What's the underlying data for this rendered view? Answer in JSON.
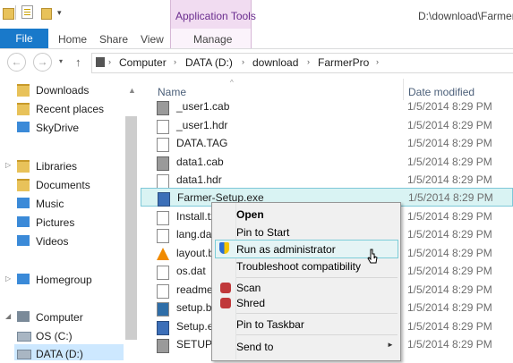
{
  "window": {
    "path_title": "D:\\download\\FarmerPro",
    "contextual_tab_group": "Application Tools"
  },
  "ribbon": {
    "tabs": [
      "File",
      "Home",
      "Share",
      "View",
      "Manage"
    ]
  },
  "address": {
    "crumbs": [
      "Computer",
      "DATA (D:)",
      "download",
      "FarmerPro"
    ]
  },
  "nav": {
    "items": [
      {
        "label": "Downloads",
        "icon": "downloads-icon"
      },
      {
        "label": "Recent places",
        "icon": "recent-places-icon"
      },
      {
        "label": "SkyDrive",
        "icon": "skydrive-icon"
      },
      {
        "label": "Libraries",
        "icon": "libraries-icon"
      },
      {
        "label": "Documents",
        "icon": "documents-icon"
      },
      {
        "label": "Music",
        "icon": "music-icon"
      },
      {
        "label": "Pictures",
        "icon": "pictures-icon"
      },
      {
        "label": "Videos",
        "icon": "videos-icon"
      },
      {
        "label": "Homegroup",
        "icon": "homegroup-icon"
      },
      {
        "label": "Computer",
        "icon": "computer-icon"
      },
      {
        "label": "OS (C:)",
        "icon": "drive-icon"
      },
      {
        "label": "DATA (D:)",
        "icon": "drive-icon"
      }
    ]
  },
  "columns": {
    "name": "Name",
    "date": "Date modified"
  },
  "files": [
    {
      "name": "_user1.cab",
      "date": "1/5/2014 8:29 PM",
      "icon": "cab-file-icon"
    },
    {
      "name": "_user1.hdr",
      "date": "1/5/2014 8:29 PM",
      "icon": "file-icon"
    },
    {
      "name": "DATA.TAG",
      "date": "1/5/2014 8:29 PM",
      "icon": "file-icon"
    },
    {
      "name": "data1.cab",
      "date": "1/5/2014 8:29 PM",
      "icon": "cab-file-icon"
    },
    {
      "name": "data1.hdr",
      "date": "1/5/2014 8:29 PM",
      "icon": "file-icon"
    },
    {
      "name": "Farmer-Setup.exe",
      "date": "1/5/2014 8:29 PM",
      "icon": "exe-icon"
    },
    {
      "name": "Install.tx",
      "date": "1/5/2014 8:29 PM",
      "icon": "text-file-icon"
    },
    {
      "name": "lang.dat",
      "date": "1/5/2014 8:29 PM",
      "icon": "file-icon"
    },
    {
      "name": "layout.b",
      "date": "1/5/2014 8:29 PM",
      "icon": "vlc-icon"
    },
    {
      "name": "os.dat",
      "date": "1/5/2014 8:29 PM",
      "icon": "file-icon"
    },
    {
      "name": "readme",
      "date": "1/5/2014 8:29 PM",
      "icon": "text-file-icon"
    },
    {
      "name": "setup.b",
      "date": "1/5/2014 8:29 PM",
      "icon": "image-file-icon"
    },
    {
      "name": "Setup.ex",
      "date": "1/5/2014 8:29 PM",
      "icon": "exe-icon"
    },
    {
      "name": "SETUP.I",
      "date": "1/5/2014 8:29 PM",
      "icon": "settings-file-icon"
    }
  ],
  "context_menu": {
    "items": [
      {
        "label": "Open",
        "bold": true
      },
      {
        "label": "Pin to Start"
      },
      {
        "label": "Run as administrator",
        "icon": "uac-shield-icon",
        "highlighted": true
      },
      {
        "label": "Troubleshoot compatibility"
      },
      {
        "label": "Scan",
        "icon": "malwarebytes-icon"
      },
      {
        "label": "Shred",
        "icon": "malwarebytes-icon"
      },
      {
        "label": "Pin to Taskbar"
      },
      {
        "label": "Send to",
        "submenu": true
      }
    ]
  }
}
